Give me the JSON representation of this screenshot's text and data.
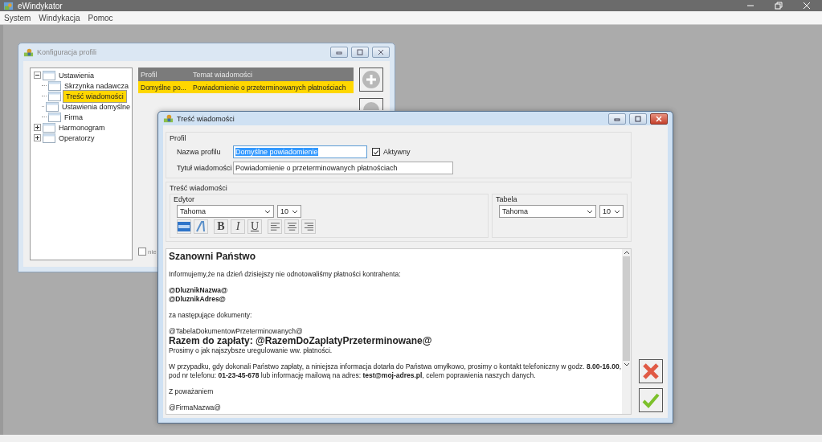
{
  "app": {
    "title": "eWindykator"
  },
  "menu": [
    {
      "label": "System"
    },
    {
      "label": "Windykacja"
    },
    {
      "label": "Pomoc"
    }
  ],
  "profiles_window": {
    "title": "Konfiguracja profili",
    "tree": [
      {
        "label": "Ustawienia",
        "expanded": true,
        "selected": false,
        "children": [
          {
            "label": "Skrzynka nadawcza",
            "selected": false
          },
          {
            "label": "Treść wiadomości",
            "selected": true
          },
          {
            "label": "Ustawienia domyślne",
            "selected": false
          },
          {
            "label": "Firma",
            "selected": false
          }
        ]
      },
      {
        "label": "Harmonogram",
        "expanded": false,
        "selected": false
      },
      {
        "label": "Operatorzy",
        "expanded": false,
        "selected": false
      }
    ],
    "table": {
      "columns": [
        "Profil",
        "Temat wiadomości"
      ],
      "rows": [
        {
          "cells": [
            "Domyślne po...",
            "Powiadomienie o przeterminowanych płatnościach"
          ],
          "selected": true
        }
      ]
    },
    "checkbox": {
      "label": "nie",
      "checked": false
    }
  },
  "message_window": {
    "title": "Treść wiadomości",
    "profile_group": {
      "title": "Profil",
      "name_label": "Nazwa profilu",
      "name_value": "Domyślne powiadomienie",
      "active": {
        "label": "Aktywny",
        "checked": true
      },
      "subject_label": "Tytuł wiadomości",
      "subject_value": "Powiadomienie o przeterminowanych płatnościach"
    },
    "content_group": {
      "title": "Treść wiadomości",
      "editor": {
        "title": "Edytor",
        "font": "Tahoma",
        "size": "10",
        "tools": [
          {
            "kind": "html"
          },
          {
            "kind": "style"
          },
          {
            "kind": "bold",
            "label": "B"
          },
          {
            "kind": "italic",
            "label": "I"
          },
          {
            "kind": "underline",
            "label": "U"
          },
          {
            "kind": "align-left"
          },
          {
            "kind": "align-center"
          },
          {
            "kind": "align-right"
          }
        ]
      },
      "table": {
        "title": "Tabela",
        "font": "Tahoma",
        "size": "10"
      }
    },
    "body": [
      {
        "kind": "title",
        "text": "Szanowni Państwo"
      },
      {
        "kind": "gap"
      },
      {
        "kind": "text",
        "text": "Informujemy,że na dzień dzisiejszy nie odnotowaliśmy płatności kontrahenta:"
      },
      {
        "kind": "gap"
      },
      {
        "kind": "bold",
        "text": "@DluznikNazwa@"
      },
      {
        "kind": "bold",
        "text": "@DluznikAdres@"
      },
      {
        "kind": "gap"
      },
      {
        "kind": "text",
        "text": "za następujące dokumenty:"
      },
      {
        "kind": "gap"
      },
      {
        "kind": "text",
        "text": "@TabelaDokumentowPrzeterminowanych@"
      },
      {
        "kind": "big",
        "text": "Razem do zapłaty: @RazemDoZaplatyPrzeterminowane@"
      },
      {
        "kind": "text",
        "text": "Prosimy o jak najszybsze uregulowanie ww. płatności."
      },
      {
        "kind": "gap"
      },
      {
        "kind": "text",
        "text": "W przypadku, gdy dokonali Państwo zapłaty, a niniejsza informacja dotarła do Państwa omyłkowo, prosimy o kontakt telefoniczny w godz. **8.00-16.00**,"
      },
      {
        "kind": "text",
        "text": "pod nr telefonu: **01-23-45-678** lub informację mailową na adres: **test@moj-adres.pl**, celem poprawienia naszych danych."
      },
      {
        "kind": "gap"
      },
      {
        "kind": "text",
        "text": "Z poważaniem"
      },
      {
        "kind": "gap"
      },
      {
        "kind": "text",
        "text": "@FirmaNazwa@"
      }
    ]
  }
}
